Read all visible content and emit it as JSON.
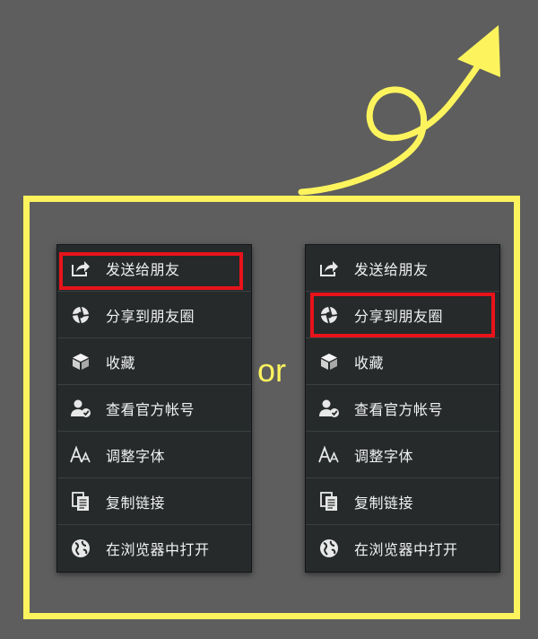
{
  "accent_color": "#fdf45d",
  "highlight_color": "#e8131b",
  "menu_background": "#262a2b",
  "separator_text": "or",
  "left_menu": {
    "highlighted_item": "发送给朋友",
    "items": [
      {
        "label": "发送给朋友",
        "icon": "share-icon"
      },
      {
        "label": "分享到朋友圈",
        "icon": "moments-icon"
      },
      {
        "label": "收藏",
        "icon": "favorite-icon"
      },
      {
        "label": "查看官方帐号",
        "icon": "official-account-icon"
      },
      {
        "label": "调整字体",
        "icon": "font-size-icon"
      },
      {
        "label": "复制链接",
        "icon": "copy-link-icon"
      },
      {
        "label": "在浏览器中打开",
        "icon": "globe-icon"
      }
    ]
  },
  "right_menu": {
    "highlighted_item": "分享到朋友圈",
    "items": [
      {
        "label": "发送给朋友",
        "icon": "share-icon"
      },
      {
        "label": "分享到朋友圈",
        "icon": "moments-icon"
      },
      {
        "label": "收藏",
        "icon": "favorite-icon"
      },
      {
        "label": "查看官方帐号",
        "icon": "official-account-icon"
      },
      {
        "label": "调整字体",
        "icon": "font-size-icon"
      },
      {
        "label": "复制链接",
        "icon": "copy-link-icon"
      },
      {
        "label": "在浏览器中打开",
        "icon": "globe-icon"
      }
    ]
  }
}
